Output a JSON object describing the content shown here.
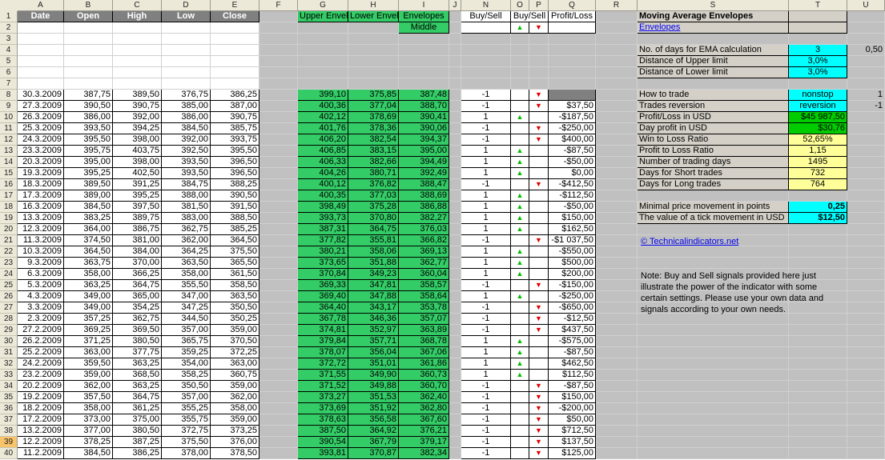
{
  "columns": [
    "A",
    "B",
    "C",
    "D",
    "E",
    "F",
    "G",
    "H",
    "I",
    "J",
    "N",
    "O",
    "P",
    "Q",
    "R",
    "S",
    "T",
    "U"
  ],
  "row_numbers": [
    "1",
    "2",
    "3",
    "4",
    "5",
    "6",
    "7",
    "8",
    "9",
    "10",
    "11",
    "12",
    "13",
    "14",
    "15",
    "16",
    "17",
    "18",
    "19",
    "20",
    "21",
    "22",
    "23",
    "24",
    "25",
    "26",
    "27",
    "28",
    "29",
    "30",
    "31",
    "32",
    "33",
    "34",
    "35",
    "36",
    "37",
    "38",
    "39",
    "40"
  ],
  "headers": {
    "date": "Date",
    "open": "Open",
    "high": "High",
    "low": "Low",
    "close": "Close",
    "upper": "Upper Envel",
    "lower": "Lower Envel",
    "middle_top": "Envelopes",
    "middle_bottom": "Middle",
    "buysell_n": "Buy/Sell",
    "buysell_op": "Buy/Sell",
    "pl": "Profit/Loss"
  },
  "signals_header": {
    "up": "▲",
    "down": "▼"
  },
  "rows": [
    [
      "30.3.2009",
      "387,75",
      "389,50",
      "376,75",
      "386,25",
      "399,10",
      "375,85",
      "387,48",
      "-1",
      "",
      "dn",
      ""
    ],
    [
      "27.3.2009",
      "390,50",
      "390,75",
      "385,00",
      "387,00",
      "400,36",
      "377,04",
      "388,70",
      "-1",
      "",
      "dn",
      "$37,50"
    ],
    [
      "26.3.2009",
      "386,00",
      "392,00",
      "386,00",
      "390,75",
      "402,12",
      "378,69",
      "390,41",
      "1",
      "up",
      "",
      "-$187,50"
    ],
    [
      "25.3.2009",
      "393,50",
      "394,25",
      "384,50",
      "385,75",
      "401,76",
      "378,36",
      "390,06",
      "-1",
      "",
      "dn",
      "-$250,00"
    ],
    [
      "24.3.2009",
      "395,50",
      "398,00",
      "392,00",
      "393,75",
      "406,20",
      "382,54",
      "394,37",
      "-1",
      "",
      "dn",
      "$400,00"
    ],
    [
      "23.3.2009",
      "395,75",
      "403,75",
      "392,50",
      "395,50",
      "406,85",
      "383,15",
      "395,00",
      "1",
      "up",
      "",
      "-$87,50"
    ],
    [
      "20.3.2009",
      "395,00",
      "398,00",
      "393,50",
      "396,50",
      "406,33",
      "382,66",
      "394,49",
      "1",
      "up",
      "",
      "-$50,00"
    ],
    [
      "19.3.2009",
      "395,25",
      "402,50",
      "393,50",
      "396,50",
      "404,26",
      "380,71",
      "392,49",
      "1",
      "up",
      "",
      "$0,00"
    ],
    [
      "18.3.2009",
      "389,50",
      "391,25",
      "384,75",
      "388,25",
      "400,12",
      "376,82",
      "388,47",
      "-1",
      "",
      "dn",
      "-$412,50"
    ],
    [
      "17.3.2009",
      "389,00",
      "395,25",
      "388,00",
      "390,50",
      "400,35",
      "377,03",
      "388,69",
      "1",
      "up",
      "",
      "-$112,50"
    ],
    [
      "16.3.2009",
      "384,50",
      "397,50",
      "381,50",
      "391,50",
      "398,49",
      "375,28",
      "386,88",
      "1",
      "up",
      "",
      "-$50,00"
    ],
    [
      "13.3.2009",
      "383,25",
      "389,75",
      "383,00",
      "388,50",
      "393,73",
      "370,80",
      "382,27",
      "1",
      "up",
      "",
      "$150,00"
    ],
    [
      "12.3.2009",
      "364,00",
      "386,75",
      "362,75",
      "385,25",
      "387,31",
      "364,75",
      "376,03",
      "1",
      "up",
      "",
      "$162,50"
    ],
    [
      "11.3.2009",
      "374,50",
      "381,00",
      "362,00",
      "364,50",
      "377,82",
      "355,81",
      "366,82",
      "-1",
      "",
      "dn",
      "-$1 037,50"
    ],
    [
      "10.3.2009",
      "364,50",
      "384,00",
      "364,25",
      "375,50",
      "380,21",
      "358,06",
      "369,13",
      "1",
      "up",
      "",
      "-$550,00"
    ],
    [
      "9.3.2009",
      "363,75",
      "370,00",
      "363,50",
      "365,50",
      "373,65",
      "351,88",
      "362,77",
      "1",
      "up",
      "",
      "$500,00"
    ],
    [
      "6.3.2009",
      "358,00",
      "366,25",
      "358,00",
      "361,50",
      "370,84",
      "349,23",
      "360,04",
      "1",
      "up",
      "",
      "$200,00"
    ],
    [
      "5.3.2009",
      "363,25",
      "364,75",
      "355,50",
      "358,50",
      "369,33",
      "347,81",
      "358,57",
      "-1",
      "",
      "dn",
      "-$150,00"
    ],
    [
      "4.3.2009",
      "349,00",
      "365,00",
      "347,00",
      "363,50",
      "369,40",
      "347,88",
      "358,64",
      "1",
      "up",
      "",
      "-$250,00"
    ],
    [
      "3.3.2009",
      "349,00",
      "354,25",
      "347,25",
      "350,50",
      "364,40",
      "343,17",
      "353,78",
      "-1",
      "",
      "dn",
      "-$650,00"
    ],
    [
      "2.3.2009",
      "357,25",
      "362,75",
      "344,50",
      "350,25",
      "367,78",
      "346,36",
      "357,07",
      "-1",
      "",
      "dn",
      "-$12,50"
    ],
    [
      "27.2.2009",
      "369,25",
      "369,50",
      "357,00",
      "359,00",
      "374,81",
      "352,97",
      "363,89",
      "-1",
      "",
      "dn",
      "$437,50"
    ],
    [
      "26.2.2009",
      "371,25",
      "380,50",
      "365,75",
      "370,50",
      "379,84",
      "357,71",
      "368,78",
      "1",
      "up",
      "",
      "-$575,00"
    ],
    [
      "25.2.2009",
      "363,00",
      "377,75",
      "359,25",
      "372,25",
      "378,07",
      "356,04",
      "367,06",
      "1",
      "up",
      "",
      "-$87,50"
    ],
    [
      "24.2.2009",
      "359,50",
      "363,25",
      "354,00",
      "363,00",
      "372,72",
      "351,01",
      "361,86",
      "1",
      "up",
      "",
      "$462,50"
    ],
    [
      "23.2.2009",
      "359,00",
      "368,50",
      "358,25",
      "360,75",
      "371,55",
      "349,90",
      "360,73",
      "1",
      "up",
      "",
      "$112,50"
    ],
    [
      "20.2.2009",
      "362,00",
      "363,25",
      "350,50",
      "359,00",
      "371,52",
      "349,88",
      "360,70",
      "-1",
      "",
      "dn",
      "-$87,50"
    ],
    [
      "19.2.2009",
      "357,50",
      "364,75",
      "357,00",
      "362,00",
      "373,27",
      "351,53",
      "362,40",
      "-1",
      "",
      "dn",
      "$150,00"
    ],
    [
      "18.2.2009",
      "358,00",
      "361,25",
      "355,25",
      "358,00",
      "373,69",
      "351,92",
      "362,80",
      "-1",
      "",
      "dn",
      "-$200,00"
    ],
    [
      "17.2.2009",
      "373,00",
      "375,00",
      "355,75",
      "359,00",
      "378,63",
      "356,58",
      "367,60",
      "-1",
      "",
      "dn",
      "$50,00"
    ],
    [
      "13.2.2009",
      "377,00",
      "380,50",
      "372,75",
      "373,25",
      "387,50",
      "364,92",
      "376,21",
      "-1",
      "",
      "dn",
      "$712,50"
    ],
    [
      "12.2.2009",
      "378,25",
      "387,25",
      "375,50",
      "376,00",
      "390,54",
      "367,79",
      "379,17",
      "-1",
      "",
      "dn",
      "$137,50"
    ],
    [
      "11.2.2009",
      "384,50",
      "386,25",
      "378,00",
      "378,50",
      "393,81",
      "370,87",
      "382,34",
      "-1",
      "",
      "dn",
      "$125,00"
    ]
  ],
  "panel": {
    "title": "Moving Average Envelopes",
    "link": "Envelopes",
    "ema_label": "No. of days for EMA calculation",
    "ema_value": "3",
    "ema_extra": "0,50",
    "upper_label": "Distance of Upper limit",
    "upper_value": "3,0%",
    "lower_label": "Distance of Lower limit",
    "lower_value": "3,0%",
    "how_label": "How to trade",
    "how_value": "nonstop",
    "how_extra": "1",
    "rev_label": "Trades reversion",
    "rev_value": "reversion",
    "rev_extra": "-1",
    "pl_label": "Profit/Loss in USD",
    "pl_value": "$45 987,50",
    "day_label": "Day profit in USD",
    "day_value": "$30,76",
    "win_label": "Win to Loss Ratio",
    "win_value": "52,65%",
    "ptl_label": "Profit to Loss Ratio",
    "ptl_value": "1,15",
    "days_label": "Number of trading days",
    "days_value": "1495",
    "short_label": "Days for Short trades",
    "short_value": "732",
    "long_label": "Days for Long trades",
    "long_value": "764",
    "min_label": "Minimal price movement in points",
    "min_value": "0,25",
    "tick_label": "The value of a tick movement in USD",
    "tick_value": "$12,50",
    "site": "© Technicalindicators.net",
    "note": "Note: Buy and Sell signals provided here just illustrate the power of the indicator with some certain settings. Please use your own data and signals according to your own needs."
  },
  "colors": {
    "envelope": "#33cc66",
    "cyan": "#00ffff",
    "yellow": "#ffff99",
    "green": "#00cc00",
    "up": "#00bb00",
    "down": "#e00000"
  }
}
